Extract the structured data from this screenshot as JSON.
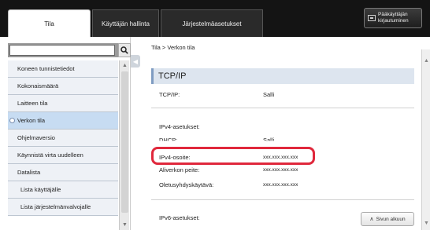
{
  "tabs": [
    {
      "label": "Tila",
      "active": true
    },
    {
      "label": "Käyttäjän hallinta",
      "active": false
    },
    {
      "label": "Järjestelmäasetukset",
      "active": false
    }
  ],
  "admin_login": {
    "line1": "Pääkäyttäjän",
    "line2": "kirjautuminen",
    "icon": "login-icon"
  },
  "search": {
    "value": "",
    "icon": "search-icon"
  },
  "sidebar": {
    "items": [
      {
        "label": "Koneen tunnistetiedot"
      },
      {
        "label": "Kokonaismäärä"
      },
      {
        "label": "Laitteen tila"
      },
      {
        "label": "Verkon tila",
        "active": true
      },
      {
        "label": "Ohjelmaversio"
      },
      {
        "label": "Käynnistä virta uudelleen"
      },
      {
        "label": "Datalista"
      },
      {
        "label": "Lista käyttäjälle",
        "sub": true
      },
      {
        "label": "Lista järjestelmänvalvojalle",
        "sub": true
      }
    ]
  },
  "breadcrumb": "Tila >  Verkon tila",
  "section": {
    "title": "TCP/IP"
  },
  "fields": {
    "tcpip_label": "TCP/IP:",
    "tcpip_value": "Salli",
    "ipv4_header": "IPv4-asetukset:",
    "dhcp_label": "DHCP:",
    "dhcp_value": "Salli",
    "ipv4_label": "IPv4-osoite:",
    "ipv4_value": "xxx.xxx.xxx.xxx",
    "subnet_label": "Aliverkon peite:",
    "subnet_value": "xxx.xxx.xxx.xxx",
    "gateway_label": "Oletusyhdyskäytävä:",
    "gateway_value": "xxx.xxx.xxx.xxx",
    "ipv6_header": "IPv6-asetukset:"
  },
  "back_to_top": "Sivun alkuun",
  "colors": {
    "highlight": "#e0283c",
    "active_nav": "#c7dcf2",
    "topbar": "#141414"
  }
}
